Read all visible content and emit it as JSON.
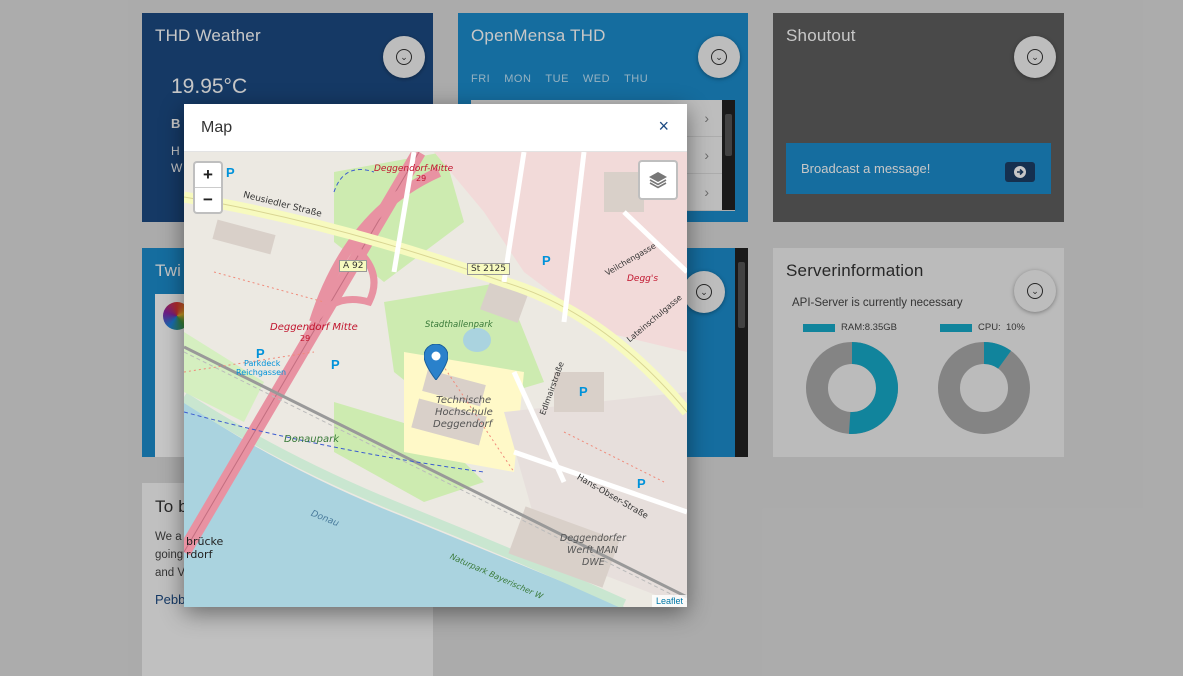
{
  "weather": {
    "title": "THD Weather",
    "temp": "19.95°C",
    "line1": "B",
    "line2": "H",
    "line3": "W"
  },
  "mensa": {
    "title": "OpenMensa THD",
    "days": [
      "FRI",
      "MON",
      "TUE",
      "WED",
      "THU"
    ]
  },
  "shoutout": {
    "title": "Shoutout",
    "broadcast_label": "Broadcast a message!"
  },
  "twitter": {
    "title": "Twi"
  },
  "server": {
    "title": "Serverinformation",
    "subtitle": "API-Server is currently necessary",
    "ram_label": "RAM:8.35GB",
    "cpu_label": "CPU:",
    "cpu_value": "10%",
    "ram_fraction": 0.51,
    "cpu_fraction": 0.1
  },
  "tbc": {
    "title": "To b",
    "line1": "We a",
    "line2": "goingrdorf",
    "line3": "and V",
    "link": "Pebb"
  },
  "modal": {
    "title": "Map",
    "close": "×"
  },
  "map": {
    "zoom_in": "+",
    "zoom_out": "−",
    "attribution": "Leaflet",
    "labels": {
      "deggendorf_mitte_top": "Deggendorf-Mitte",
      "num_29_top": "29",
      "neusiedler": "Neusiedler Straße",
      "a92": "A 92",
      "st2125": "St 2125",
      "deggendorf_mitte": "Deggendorf Mitte",
      "num_29": "29",
      "parkdeck": "Parkdeck",
      "reichgassen": "Reichgassen",
      "stadthallenpark": "Stadthallenpark",
      "thd1": "Technische",
      "thd2": "Hochschule",
      "thd3": "Deggendorf",
      "donaupark": "Donaupark",
      "donau": "Donau",
      "hans_obser": "Hans-Obser-Straße",
      "werft1": "Deggendorfer",
      "werft2": "Werft MAN",
      "werft3": "DWE",
      "naturpark": "Naturpark Bayerischer W",
      "veilchengasse": "Veilchengasse",
      "degg": "Degg's",
      "latein": "Lateinschulgasse",
      "edlmair": "Edlmairstraße",
      "brucke": "brücke",
      "gondorf": "rdorf"
    }
  },
  "colors": {
    "weather": "#1c4a82",
    "mensa": "#1b8ccc",
    "shoutout": "#5e5e5e",
    "accent": "#17a9c8"
  }
}
